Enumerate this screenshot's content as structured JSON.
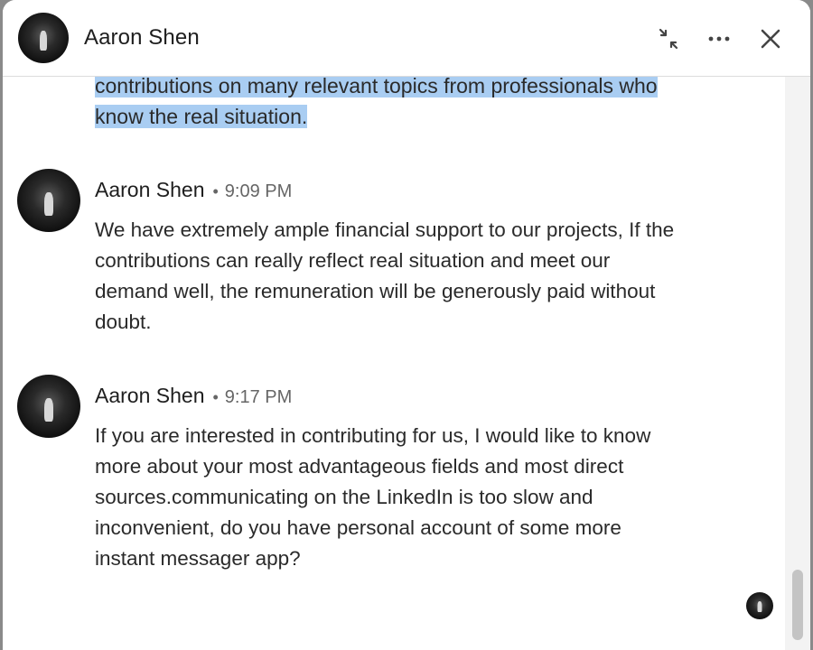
{
  "header": {
    "title": "Aaron Shen",
    "icons": {
      "minimize": "minimize-arrows-icon",
      "more": "more-horizontal-icon",
      "close": "close-icon"
    }
  },
  "thread": {
    "highlighted_tail": {
      "line1": "contributions on many relevant topics from professionals who",
      "line2": "know the real situation."
    },
    "messages": [
      {
        "sender": "Aaron Shen",
        "separator": "•",
        "time": "9:09 PM",
        "lines": [
          "We have extremely ample financial support to our projects, If the",
          "contributions can really reflect real situation and meet our",
          "demand well, the remuneration will be generously paid without",
          "doubt."
        ]
      },
      {
        "sender": "Aaron Shen",
        "separator": "•",
        "time": "9:17 PM",
        "lines": [
          "If you are interested in contributing for us, I would like to know",
          "more about your most advantageous fields and most direct",
          "sources.communicating on the LinkedIn is too slow and",
          "inconvenient, do you have personal account of some more",
          "instant messager app?"
        ]
      }
    ]
  },
  "colors": {
    "highlight": "#a9cdf2",
    "text": "#2a2a2a",
    "timestamp": "#666666"
  }
}
